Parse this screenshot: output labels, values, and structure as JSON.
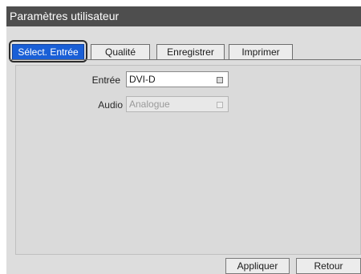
{
  "window": {
    "title": "Paramètres utilisateur"
  },
  "tabs": [
    {
      "label": "Sélect. Entrée",
      "active": true
    },
    {
      "label": "Qualité",
      "active": false
    },
    {
      "label": "Enregistrer",
      "active": false
    },
    {
      "label": "Imprimer",
      "active": false
    }
  ],
  "fields": {
    "input": {
      "label": "Entrée",
      "value": "DVI-D",
      "enabled": true
    },
    "audio": {
      "label": "Audio",
      "value": "Analogue",
      "enabled": false
    }
  },
  "footer": {
    "apply_label": "Appliquer",
    "back_label": "Retour"
  },
  "colors": {
    "titlebar": "#4e4e4e",
    "active_tab": "#1a5fd6",
    "panel": "#dddddd"
  }
}
